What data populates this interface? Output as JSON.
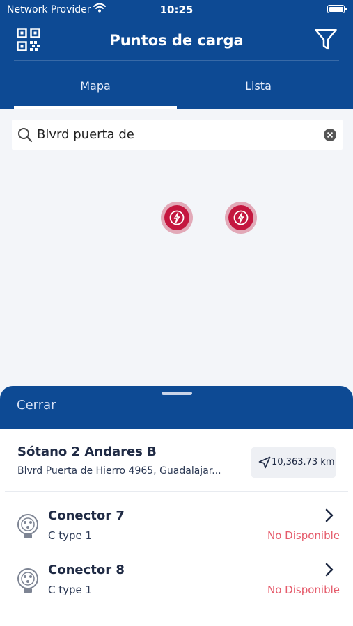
{
  "status_bar": {
    "carrier": "Network Provider",
    "time": "10:25"
  },
  "header": {
    "title": "Puntos de carga",
    "qr_icon": "qr-code-icon",
    "filter_icon": "filter-icon"
  },
  "tabs": [
    {
      "label": "Mapa",
      "active": true
    },
    {
      "label": "Lista",
      "active": false
    }
  ],
  "search": {
    "value": "Blvrd puerta de",
    "icon": "search-icon",
    "clear_icon": "clear-icon"
  },
  "map": {
    "pins": [
      {
        "icon": "lightning-icon",
        "color": "#c4163f"
      },
      {
        "icon": "lightning-icon",
        "color": "#c4163f"
      }
    ]
  },
  "sheet": {
    "close_label": "Cerrar",
    "station": {
      "name": "Sótano 2 Andares B",
      "address": "Blvrd Puerta de Hierro 4965, Guadalajar...",
      "distance": "10,363.73 km"
    },
    "connectors": [
      {
        "name": "Conector 7",
        "type": "C type 1",
        "status": "No Disponible"
      },
      {
        "name": "Conector 8",
        "type": "C type 1",
        "status": "No Disponible"
      }
    ]
  },
  "colors": {
    "primary": "#0d4a94",
    "pin": "#c4163f",
    "status_unavailable": "#e55b6b"
  }
}
